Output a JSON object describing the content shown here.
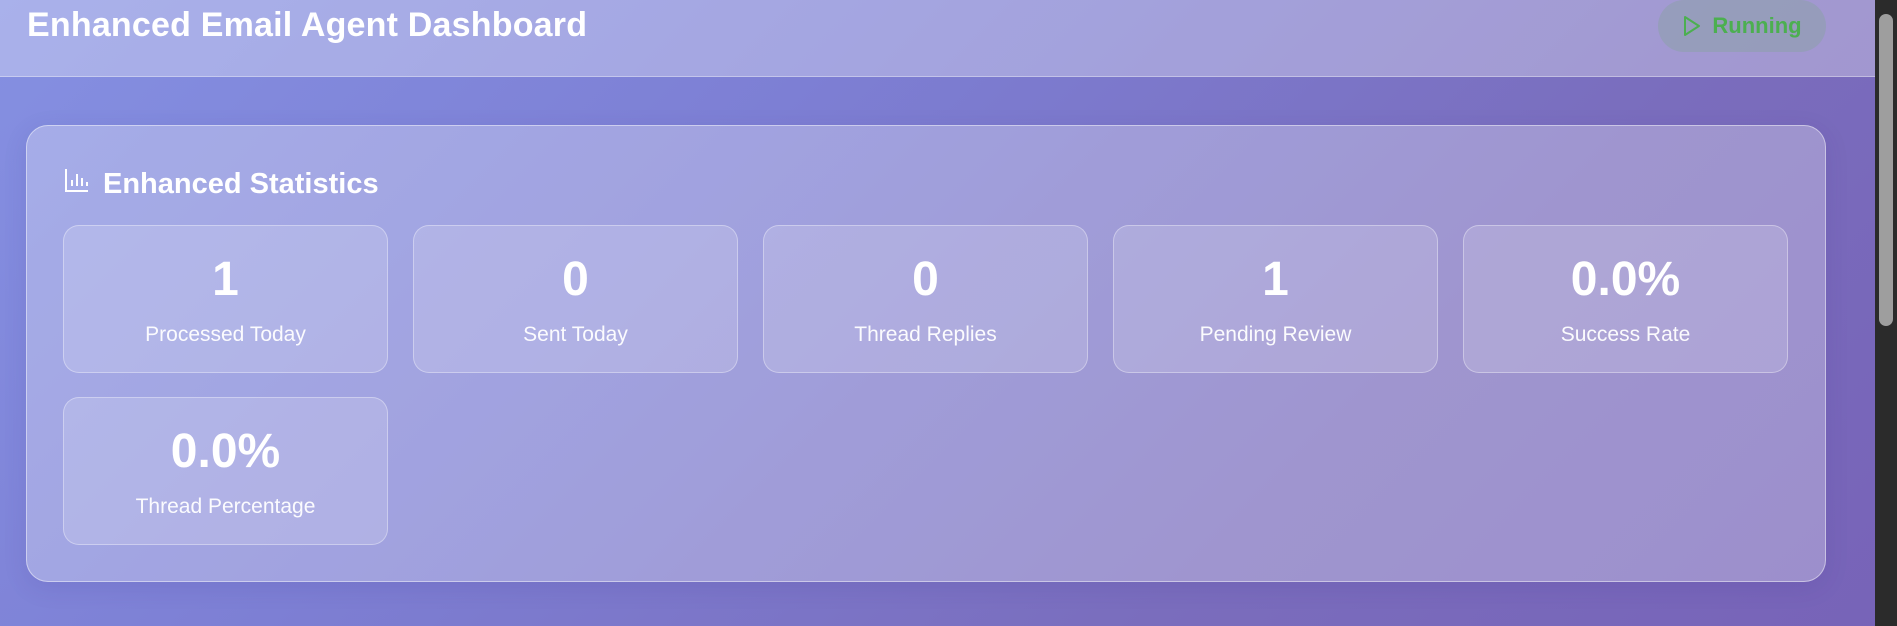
{
  "header": {
    "title": "Enhanced Email Agent Dashboard",
    "status": {
      "label": "Running",
      "icon": "play-icon",
      "color": "#4caf50"
    }
  },
  "statistics": {
    "heading": "Enhanced Statistics",
    "icon": "bar-chart-icon",
    "cards": [
      {
        "value": "1",
        "label": "Processed Today"
      },
      {
        "value": "0",
        "label": "Sent Today"
      },
      {
        "value": "0",
        "label": "Thread Replies"
      },
      {
        "value": "1",
        "label": "Pending Review"
      },
      {
        "value": "0.0%",
        "label": "Success Rate"
      },
      {
        "value": "0.0%",
        "label": "Thread Percentage"
      }
    ]
  },
  "colors": {
    "background_gradient": [
      "#8590e2",
      "#7763b8"
    ],
    "text": "#ffffff",
    "status_accent": "#4caf50"
  }
}
